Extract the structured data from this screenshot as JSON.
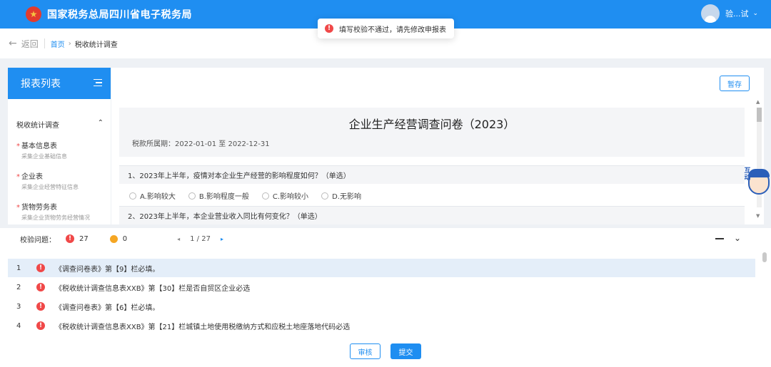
{
  "header": {
    "site_title": "国家税务总局四川省电子税务局",
    "username": "验...试",
    "chevron": "⌄"
  },
  "toast": {
    "message": "填写校验不通过，请先修改申报表",
    "icon": "!"
  },
  "breadcrumb": {
    "back_label": "返回",
    "back_arrow": "←",
    "home": "首页",
    "separator": "›",
    "current": "税收统计调查"
  },
  "sidebar": {
    "title": "报表列表",
    "group_label": "税收统计调查",
    "group_chevron": "⌃",
    "items": [
      {
        "label": "基本信息表",
        "sub": "采集企业基础信息"
      },
      {
        "label": "企业表",
        "sub": "采集企业经营特征信息"
      },
      {
        "label": "货物劳务表",
        "sub": "采集企业货物劳务经营情况"
      }
    ]
  },
  "main": {
    "save_label": "暂存",
    "questionnaire_title": "企业生产经营调查问卷（2023）",
    "period_label": "税款所属期：2022-01-01 至 2022-12-31",
    "questions": [
      {
        "text": "1、2023年上半年，疫情对本企业生产经营的影响程度如何？（单选）",
        "options": [
          "A.影响较大",
          "B.影响程度一般",
          "C.影响较小",
          "D.无影响"
        ]
      },
      {
        "text": "2、2023年上半年，本企业营业收入同比有何变化？（单选）"
      }
    ]
  },
  "mascot": {
    "text": "互动"
  },
  "validation": {
    "label": "校验问题：",
    "error_count": "27",
    "warning_count": "0",
    "page_text": "1 / 27",
    "prev_icon": "◂",
    "next_icon": "▸",
    "collapse_icon": "⌄",
    "rows": [
      {
        "num": "1",
        "text": "《调查问卷表》第【9】栏必填。"
      },
      {
        "num": "2",
        "text": "《税收统计调查信息表XXB》第【30】栏是否自贸区企业必选"
      },
      {
        "num": "3",
        "text": "《调查问卷表》第【6】栏必填。"
      },
      {
        "num": "4",
        "text": "《税收统计调查信息表XXB》第【21】栏城镇土地使用税缴纳方式和应税土地座落地代码必选"
      }
    ]
  },
  "footer": {
    "review_label": "审核",
    "submit_label": "提交"
  },
  "colors": {
    "primary": "#1f8ef1",
    "error": "#f04848",
    "warning": "#f5a623"
  }
}
